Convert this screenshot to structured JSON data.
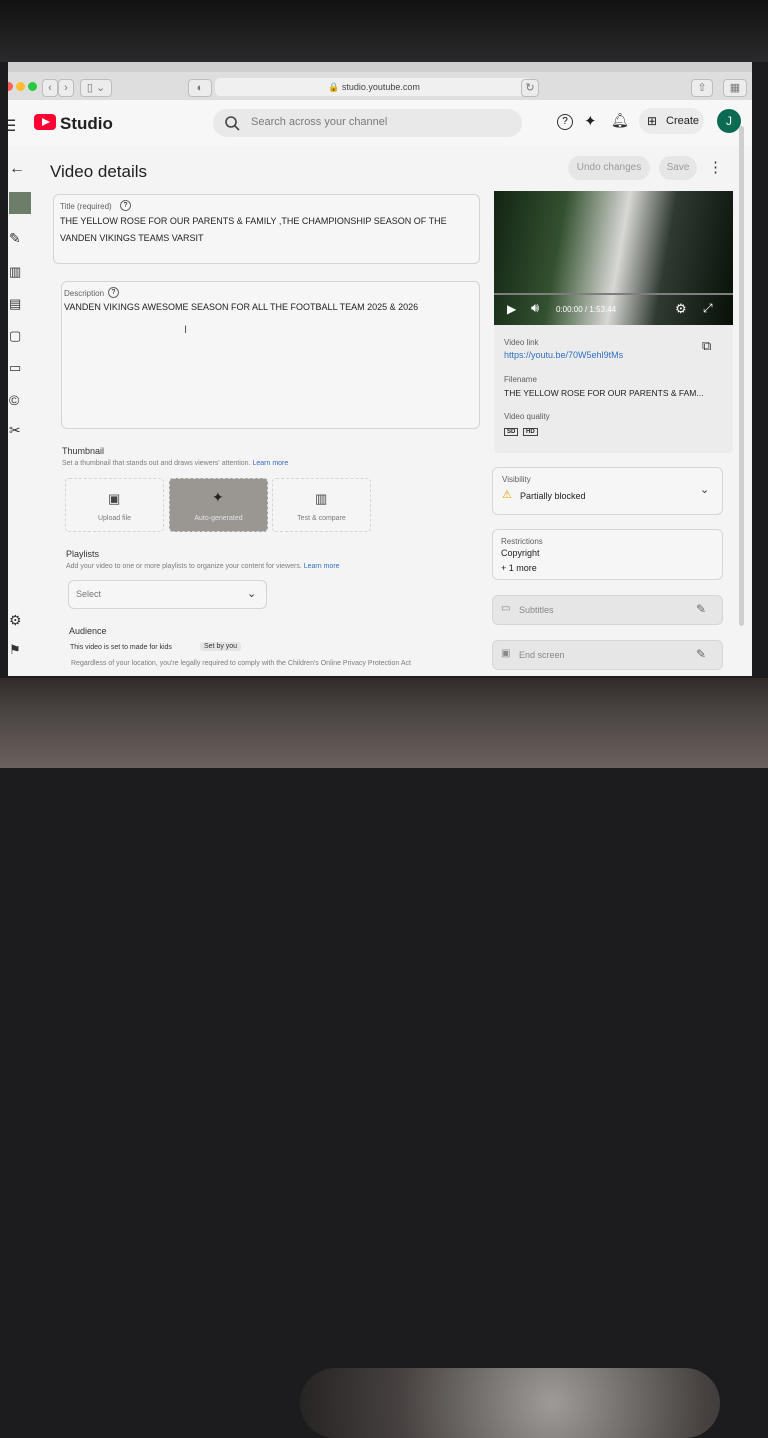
{
  "browser": {
    "url": "studio.youtube.com"
  },
  "header": {
    "logo": "Studio",
    "search_placeholder": "Search across your channel",
    "create_label": "Create",
    "avatar_letter": "J"
  },
  "page": {
    "title": "Video details",
    "undo_label": "Undo changes",
    "save_label": "Save"
  },
  "title_field": {
    "label": "Title (required)",
    "value": "THE YELLOW ROSE FOR OUR PARENTS & FAMILY ,THE CHAMPIONSHIP SEASON OF THE VANDEN VIKINGS TEAMS VARSIT"
  },
  "description_field": {
    "label": "Description",
    "value": "VANDEN VIKINGS AWESOME SEASON FOR ALL THE FOOTBALL TEAM 2025 & 2026"
  },
  "thumbnail": {
    "heading": "Thumbnail",
    "help": "Set a thumbnail that stands out and draws viewers' attention.",
    "learn_more": "Learn more",
    "options": [
      "Upload file",
      "Auto-generated",
      "Test & compare"
    ]
  },
  "playlists": {
    "heading": "Playlists",
    "help": "Add your video to one or more playlists to organize your content for viewers.",
    "learn_more": "Learn more",
    "select_value": "Select"
  },
  "audience": {
    "heading": "Audience",
    "status": "This video is set to made for kids",
    "badge": "Set by you",
    "note": "Regardless of your location, you're legally required to comply with the Children's Online Privacy Protection Act"
  },
  "video": {
    "time": "0:00:00 / 1:53:44",
    "link_label": "Video link",
    "link": "https://youtu.be/70W5ehl9tMs",
    "filename_label": "Filename",
    "filename": "THE YELLOW ROSE FOR OUR PARENTS & FAM...",
    "quality_label": "Video quality",
    "quality": [
      "SD",
      "HD"
    ]
  },
  "visibility": {
    "label": "Visibility",
    "value": "Partially blocked"
  },
  "restrictions": {
    "label": "Restrictions",
    "value": "Copyright",
    "more": "+ 1 more"
  },
  "side_actions": {
    "subtitles": "Subtitles",
    "end_screen": "End screen"
  },
  "colors": {
    "youtube_red": "#ff0033",
    "link_blue": "#2f6fc0",
    "avatar_green": "#0b6b52",
    "warning": "#e8a000"
  }
}
